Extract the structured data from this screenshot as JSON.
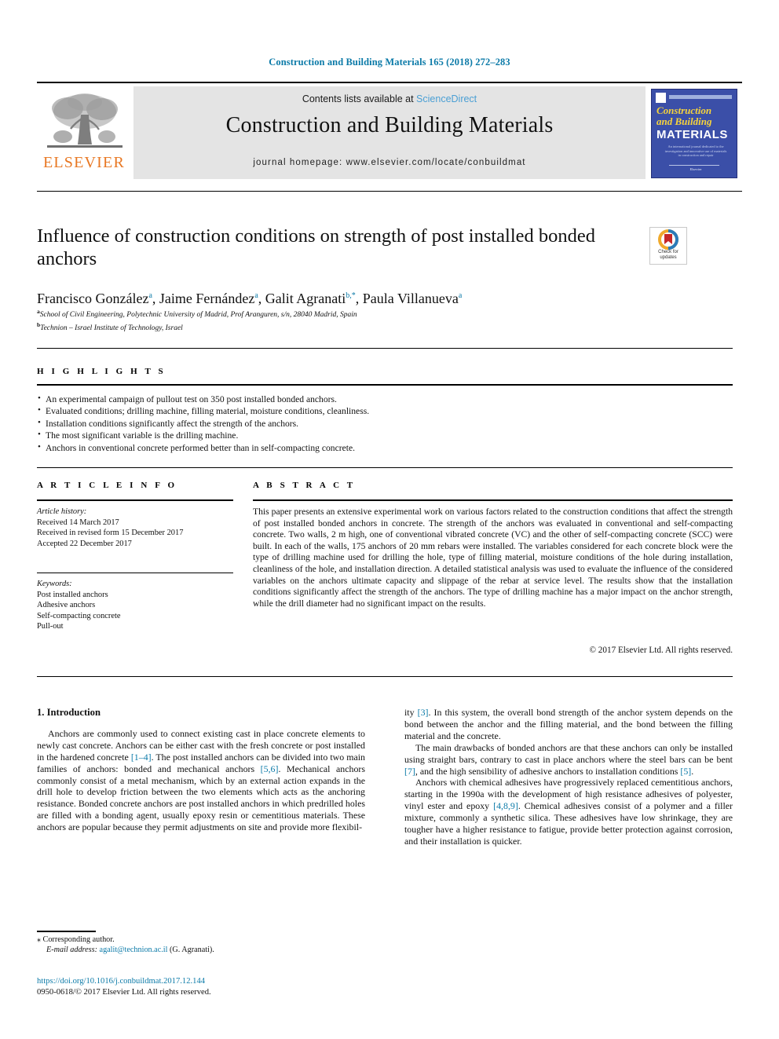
{
  "running_head": "Construction and Building Materials 165 (2018) 272–283",
  "masthead": {
    "contents_prefix": "Contents lists available at ",
    "sciencedirect": "ScienceDirect",
    "journal_title": "Construction and Building Materials",
    "homepage": "journal homepage: www.elsevier.com/locate/conbuildmat",
    "publisher_wordmark": "ELSEVIER",
    "publisher_logo_icon": "elsevier-tree-icon",
    "cover": {
      "line1": "Construction",
      "line2": "and Building",
      "line3": "MATERIALS",
      "blurb": "An international journal dedicated to the investigation and innovative use of materials in construction and repair",
      "footer": "Elsevier"
    }
  },
  "article": {
    "title": "Influence of construction conditions on strength of post installed bonded anchors",
    "authors": [
      {
        "name": "Francisco González",
        "marks": "a"
      },
      {
        "name": "Jaime Fernández",
        "marks": "a"
      },
      {
        "name": "Galit Agranati",
        "marks": "b,*"
      },
      {
        "name": "Paula Villanueva",
        "marks": "a"
      }
    ],
    "affiliations": [
      {
        "mark": "a",
        "text": "School of Civil Engineering, Polytechnic University of Madrid, Prof Aranguren, s/n, 28040 Madrid, Spain"
      },
      {
        "mark": "b",
        "text": "Technion – Israel Institute of Technology, Israel"
      }
    ],
    "crossmark": {
      "icon": "crossmark-badge-icon",
      "label_line1": "Check for",
      "label_line2": "updates"
    }
  },
  "highlights": {
    "heading": "H I G H L I G H T S",
    "items": [
      "An experimental campaign of pullout test on 350 post installed bonded anchors.",
      "Evaluated conditions; drilling machine, filling material, moisture conditions, cleanliness.",
      "Installation conditions significantly affect the strength of the anchors.",
      "The most significant variable is the drilling machine.",
      "Anchors in conventional concrete performed better than in self-compacting concrete."
    ]
  },
  "article_info": {
    "heading": "A R T I C L E   I N F O",
    "history_label": "Article history:",
    "history": [
      "Received 14 March 2017",
      "Received in revised form 15 December 2017",
      "Accepted 22 December 2017"
    ],
    "keywords_label": "Keywords:",
    "keywords": [
      "Post installed anchors",
      "Adhesive anchors",
      "Self-compacting concrete",
      "Pull-out"
    ]
  },
  "abstract": {
    "heading": "A B S T R A C T",
    "text": "This paper presents an extensive experimental work on various factors related to the construction conditions that affect the strength of post installed bonded anchors in concrete. The strength of the anchors was evaluated in conventional and self-compacting concrete. Two walls, 2 m high, one of conventional vibrated concrete (VC) and the other of self-compacting concrete (SCC) were built. In each of the walls, 175 anchors of 20 mm rebars were installed. The variables considered for each concrete block were the type of drilling machine used for drilling the hole, type of filling material, moisture conditions of the hole during installation, cleanliness of the hole, and installation direction. A detailed statistical analysis was used to evaluate the influence of the considered variables on the anchors ultimate capacity and slippage of the rebar at service level. The results show that the installation conditions significantly affect the strength of the anchors. The type of drilling machine has a major impact on the anchor strength, while the drill diameter had no significant impact on the results.",
    "copyright": "© 2017 Elsevier Ltd. All rights reserved."
  },
  "body": {
    "section_number_title": "1. Introduction",
    "left_paragraphs": [
      "Anchors are commonly used to connect existing cast in place concrete elements to newly cast concrete. Anchors can be either cast with the fresh concrete or post installed in the hardened concrete [1–4]. The post installed anchors can be divided into two main families of anchors: bonded and mechanical anchors [5,6]. Mechanical anchors commonly consist of a metal mechanism, which by an external action expands in the drill hole to develop friction between the two elements which acts as the anchoring resistance. Bonded concrete anchors are post installed anchors in which predrilled holes are filled with a bonding agent, usually epoxy resin or cementitious materials. These anchors are popular because they permit adjustments on site and provide more flexibil-"
    ],
    "right_paragraphs": [
      "ity [3]. In this system, the overall bond strength of the anchor system depends on the bond between the anchor and the filling material, and the bond between the filling material and the concrete.",
      "The main drawbacks of bonded anchors are that these anchors can only be installed using straight bars, contrary to cast in place anchors where the steel bars can be bent [7], and the high sensibility of adhesive anchors to installation conditions [5].",
      "Anchors with chemical adhesives have progressively replaced cementitious anchors, starting in the 1990a with the development of high resistance adhesives of polyester, vinyl ester and epoxy [4,8,9]. Chemical adhesives consist of a polymer and a filler mixture, commonly a synthetic silica. These adhesives have low shrinkage, they are tougher have a higher resistance to fatigue, provide better protection against corrosion, and their installation is quicker."
    ]
  },
  "footer": {
    "corresponding_marker": "⁎",
    "corresponding_label": "Corresponding author.",
    "email_label": "E-mail address:",
    "email": "agalit@technion.ac.il",
    "email_owner": "(G. Agranati).",
    "doi": "https://doi.org/10.1016/j.conbuildmat.2017.12.144",
    "issn_line": "0950-0618/© 2017 Elsevier Ltd. All rights reserved."
  },
  "colors": {
    "link_blue": "#0b7aa8",
    "sciencedirect_blue": "#4a9fd4",
    "elsevier_orange": "#e87722",
    "cover_blue": "#3b4fa8",
    "cover_yellow": "#f6d33c"
  }
}
